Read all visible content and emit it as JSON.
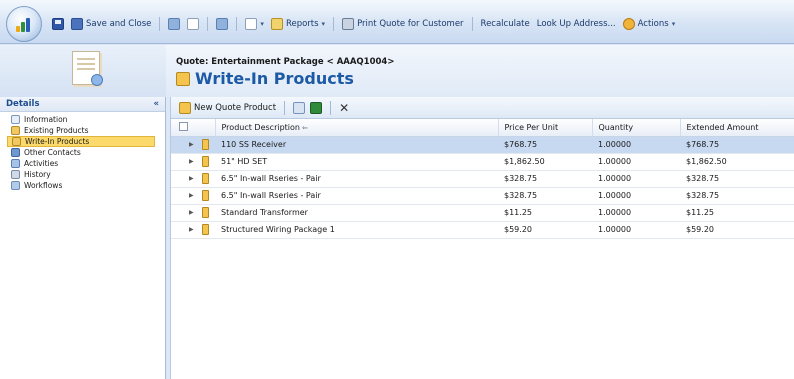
{
  "toolbar": {
    "save_close": "Save and Close",
    "reports": "Reports",
    "print_quote": "Print Quote for Customer",
    "recalculate": "Recalculate",
    "lookup_address": "Look Up Address...",
    "actions": "Actions"
  },
  "header": {
    "breadcrumb": "Quote: Entertainment Package < AAAQ1004>",
    "title": "Write-In Products"
  },
  "nav": {
    "title": "Details",
    "collapse_glyph": "«",
    "items": [
      {
        "label": "Information",
        "icon": "information-icon"
      },
      {
        "label": "Existing Products",
        "icon": "existing-products-icon"
      },
      {
        "label": "Write-In Products",
        "icon": "write-in-products-icon"
      },
      {
        "label": "Other Contacts",
        "icon": "contacts-icon"
      },
      {
        "label": "Activities",
        "icon": "activities-icon"
      },
      {
        "label": "History",
        "icon": "history-icon"
      },
      {
        "label": "Workflows",
        "icon": "workflows-icon"
      }
    ],
    "selected_index": 2
  },
  "grid": {
    "new_button": "New Quote Product",
    "columns": [
      "Product Description",
      "Price Per Unit",
      "Quantity",
      "Extended Amount"
    ],
    "sort_glyph": "⇐",
    "rows": [
      {
        "description": "110 SS Receiver",
        "price": "$768.75",
        "quantity": "1.00000",
        "extended": "$768.75"
      },
      {
        "description": "51\" HD SET",
        "price": "$1,862.50",
        "quantity": "1.00000",
        "extended": "$1,862.50"
      },
      {
        "description": "6.5\" In-wall Rseries - Pair",
        "price": "$328.75",
        "quantity": "1.00000",
        "extended": "$328.75"
      },
      {
        "description": "6.5\" In-wall Rseries - Pair",
        "price": "$328.75",
        "quantity": "1.00000",
        "extended": "$328.75"
      },
      {
        "description": "Standard Transformer",
        "price": "$11.25",
        "quantity": "1.00000",
        "extended": "$11.25"
      },
      {
        "description": "Structured Wiring Package 1",
        "price": "$59.20",
        "quantity": "1.00000",
        "extended": "$59.20"
      }
    ],
    "selected_row": 0
  }
}
